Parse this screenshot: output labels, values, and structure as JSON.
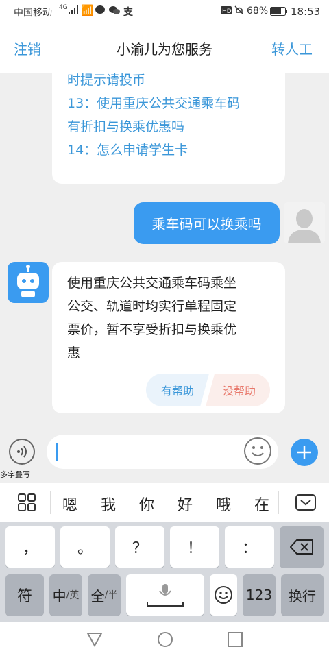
{
  "status_bar": {
    "carrier": "中国移动",
    "network": "4G",
    "battery": "68%",
    "time": "18:53"
  },
  "header": {
    "left_button": "注销",
    "title": "小渝儿为您服务",
    "right_button": "转人工"
  },
  "chat": {
    "faq_items": [
      "时提示请投币",
      "13：使用重庆公共交通乘车码",
      "有折扣与换乘优惠吗",
      "14：怎么申请学生卡"
    ],
    "user_message": "乘车码可以换乘吗",
    "bot_message_lines": [
      "使用重庆公共交通乘车码乘坐",
      "公交、轨道时均实行单程固定",
      "票价，暂不享受折扣与换乘优",
      "惠"
    ],
    "helpful_label": "有帮助",
    "not_helpful_label": "没帮助"
  },
  "input": {
    "voice_label": "多字叠写",
    "text_value": ""
  },
  "suggestions": [
    "嗯",
    "我",
    "你",
    "好",
    "哦",
    "在"
  ],
  "keyboard": {
    "row1": [
      "，",
      "。",
      "？",
      "！",
      "："
    ],
    "row2": {
      "symbol": "符",
      "chinese": "中",
      "english": "英",
      "full": "全",
      "half": "半",
      "numbers": "123",
      "enter": "换行"
    }
  },
  "colors": {
    "accent": "#3b97d9",
    "user_bubble": "#3a9bf0",
    "helpful_bg": "#eaf3fb",
    "not_helpful_bg": "#fbeeeb",
    "not_helpful_text": "#e8786b"
  }
}
